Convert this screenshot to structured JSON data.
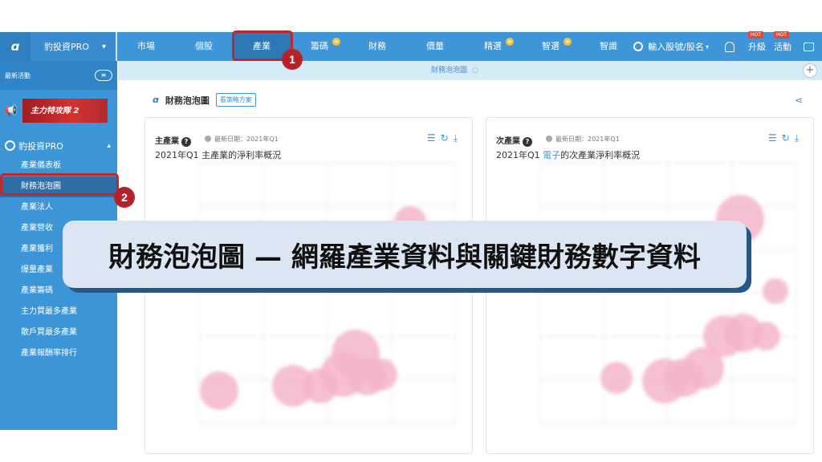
{
  "nav": {
    "logo": "ɑ",
    "brand": "豹投資PRO",
    "items": [
      {
        "label": "市場",
        "star": false
      },
      {
        "label": "個股",
        "star": false
      },
      {
        "label": "產業",
        "star": false,
        "active": true
      },
      {
        "label": "籌碼",
        "star": true
      },
      {
        "label": "財務",
        "star": false
      },
      {
        "label": "價量",
        "star": false
      },
      {
        "label": "精選",
        "star": true
      },
      {
        "label": "智選",
        "star": true
      },
      {
        "label": "智識",
        "star": false
      }
    ],
    "search_placeholder": "輸入股號/股名",
    "upgrade": "升級",
    "activity": "活動",
    "hot_label": "HOT"
  },
  "callouts": {
    "one": "1",
    "two": "2"
  },
  "sidebar": {
    "latest": "最新活動",
    "banner": "主力特攻隊 2",
    "section": "豹投資PRO",
    "items": [
      {
        "label": "產業儀表板"
      },
      {
        "label": "財務泡泡圖",
        "active": true
      },
      {
        "label": "產業法人"
      },
      {
        "label": "產業營收"
      },
      {
        "label": "產業獲利"
      },
      {
        "label": "爆量產業"
      },
      {
        "label": "產業籌碼"
      },
      {
        "label": "主力買最多產業"
      },
      {
        "label": "散戶買最多產業"
      },
      {
        "label": "產業報酬率排行"
      }
    ]
  },
  "tab": {
    "label": "財務泡泡圖"
  },
  "page": {
    "title": "財務泡泡圖",
    "strategy_button": "看策略方案"
  },
  "cards": [
    {
      "title": "主產業",
      "date": "最新日期：2021年Q1",
      "subtitle_pre": "2021年Q1 主產業的淨利率概況",
      "subtitle_hl": "",
      "subtitle_post": ""
    },
    {
      "title": "次產業",
      "date": "最新日期：2021年Q1",
      "subtitle_pre": "2021年Q1 ",
      "subtitle_hl": "電子",
      "subtitle_post": "的次產業淨利率概況"
    }
  ],
  "overlay": {
    "caption": "財務泡泡圖 — 網羅產業資料與關鍵財務數字資料"
  },
  "colors": {
    "nav": "#3e95d8",
    "bubble": "#f5b5cd",
    "callout": "#c0272d"
  }
}
